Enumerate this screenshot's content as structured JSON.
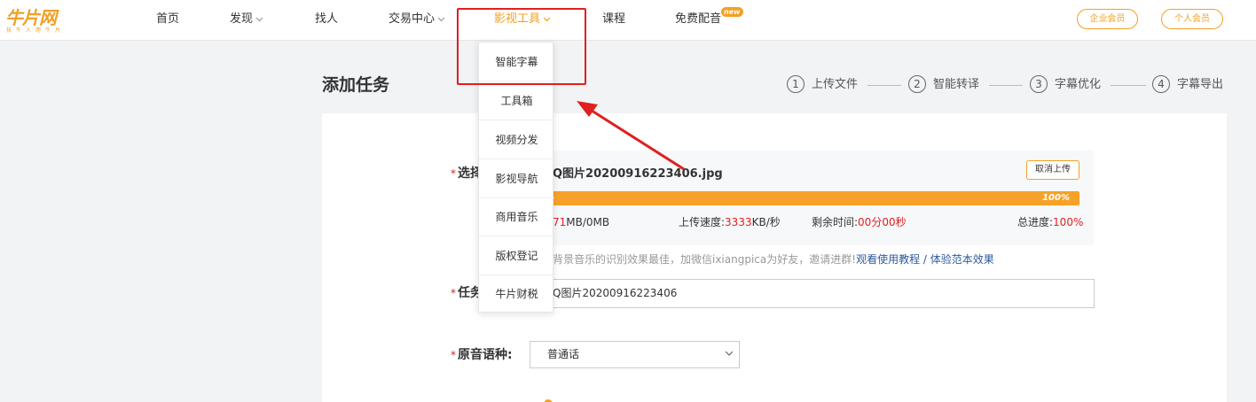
{
  "logo": {
    "main": "牛片网",
    "sub": "技牛人用牛片"
  },
  "nav": {
    "items": [
      {
        "label": "首页",
        "has_chevron": false
      },
      {
        "label": "发现",
        "has_chevron": true
      },
      {
        "label": "找人",
        "has_chevron": false
      },
      {
        "label": "交易中心",
        "has_chevron": true
      },
      {
        "label": "影视工具",
        "has_chevron": true,
        "active": true
      },
      {
        "label": "课程",
        "has_chevron": false
      },
      {
        "label": "免费配音",
        "has_chevron": false,
        "badge": "new"
      }
    ],
    "enterprise_member": "企业会员",
    "personal_member": "个人会员"
  },
  "dropdown": {
    "items": [
      "智能字幕",
      "工具箱",
      "视频分发",
      "影视导航",
      "商用音乐",
      "版权登记",
      "牛片财税"
    ]
  },
  "page": {
    "title": "添加任务",
    "steps": [
      {
        "num": "1",
        "label": "上传文件"
      },
      {
        "num": "2",
        "label": "智能转译"
      },
      {
        "num": "3",
        "label": "字幕优化"
      },
      {
        "num": "4",
        "label": "字幕导出"
      }
    ]
  },
  "form": {
    "select_file_label": "选择",
    "file_name": "Q图片20200916223406.jpg",
    "cancel_upload": "取消上传",
    "progress": {
      "percent": 100,
      "label": "100%"
    },
    "size_uploaded": "71",
    "size_rest": "MB/0MB",
    "speed_label": "上传速度:",
    "speed_value": "3333",
    "speed_unit": "KB/秒",
    "remaining_label": "剩余时间:",
    "remaining_value": "00分00秒",
    "total_label": "总进度:",
    "total_value": "100%",
    "tip_text": "背景音乐的识别效果最佳，加微信ixiangpica为好友，邀请进群!",
    "tip_link": "观看使用教程 / 体验范本效果",
    "task_label": "任务",
    "task_name_value": "Q图片20200916223406",
    "language_label": "原音语种:",
    "language_value": "普通话"
  },
  "colors": {
    "accent": "#f2a024",
    "highlight": "#e02020",
    "link": "#2c5a9c"
  }
}
